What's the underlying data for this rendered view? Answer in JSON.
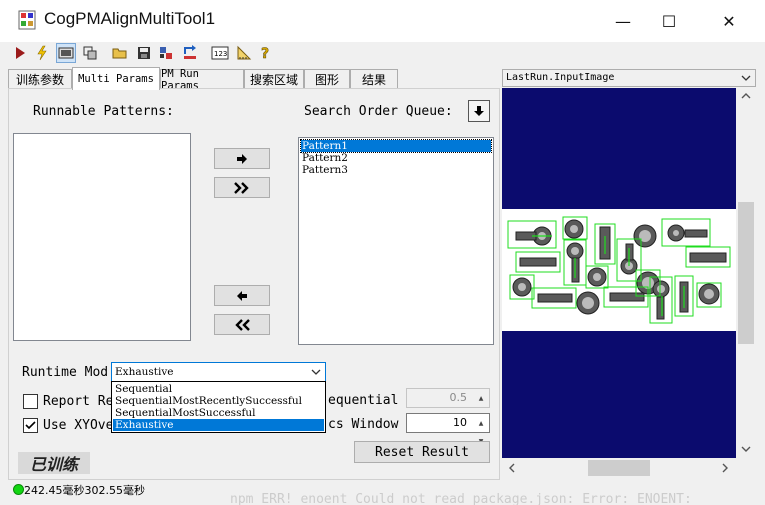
{
  "window": {
    "title": "CogPMAlignMultiTool1",
    "minimize_glyph": "—",
    "maximize_glyph": "☐",
    "close_glyph": "✕"
  },
  "toolbar": {
    "icons": [
      "run-icon",
      "electric-run-icon",
      "display-icon",
      "graphics-icon",
      "open-icon",
      "save-icon",
      "import-icon",
      "export-icon",
      "number-icon",
      "ruler-icon",
      "help-icon"
    ]
  },
  "tabs": [
    {
      "label": "训练参数"
    },
    {
      "label": "Multi Params"
    },
    {
      "label": "PM Run Params"
    },
    {
      "label": "搜索区域"
    },
    {
      "label": "图形"
    },
    {
      "label": "结果"
    }
  ],
  "multi_params": {
    "runnable_label": "Runnable Patterns:",
    "queue_label": "Search Order Queue:",
    "queue_items": [
      "Pattern1",
      "Pattern2",
      "Pattern3"
    ],
    "selected_queue_item": "Pattern1",
    "runtime_mode_label": "Runtime Mod",
    "runtime_mode_value": "Exhaustive",
    "runtime_mode_options": [
      "Sequential",
      "SequentialMostRecentlySuccessful",
      "SequentialMostSuccessful",
      "Exhaustive"
    ],
    "report_label": "Report Re",
    "report_checked": false,
    "sequential_label": "equential Th",
    "sequential_value": "0.5",
    "use_xy_label": "Use XYOve",
    "use_xy_checked": true,
    "cs_window_label": "cs Window",
    "cs_window_value": "10",
    "reset_button": "Reset Result",
    "trained_badge": "已训练"
  },
  "image_pane": {
    "selector_label": "LastRun.InputImage"
  },
  "status": {
    "text": "242.45毫秒302.55毫秒",
    "led_color": "#12d612"
  },
  "background_terminal": {
    "text": "npm ERR! enoent Could not read package.json: Error: ENOENT:"
  }
}
